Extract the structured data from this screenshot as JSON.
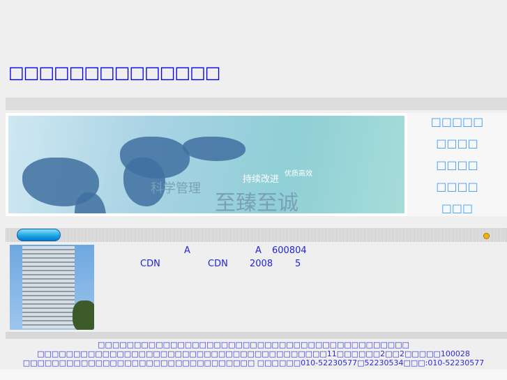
{
  "header": {
    "title": "□□□□□□□□□□□□□□"
  },
  "banner": {
    "slogan1": "科学管理",
    "slogan2": "至臻至诚",
    "slogan3": "持续改进",
    "slogan4": "优质高效"
  },
  "nav": {
    "items": [
      {
        "label": "□□□□□"
      },
      {
        "label": "□□□□"
      },
      {
        "label": "□□□□"
      },
      {
        "label": "□□□□"
      },
      {
        "label": "□□□"
      }
    ]
  },
  "content": {
    "row1": [
      "A",
      "A",
      "600804"
    ],
    "row2": [
      "CDN",
      "CDN",
      "2008",
      "5"
    ]
  },
  "footer": {
    "line1": "□□□□□□□□□□□□□□□□□□□□□□□□□□□□□□□□□□□□□□□□□□□",
    "line2": "□□□□□□□□□□□□□□□□□□□□□□□□□□□□□□□□□□□□□□□□11□□□□□□2□□2□□□□□100028",
    "line3": "□□□□□□□□□□□□□□□□□□□□□□□□□□□□□□□□ □□□□□□010-52230577□52230534□□□:010-52230577"
  },
  "colors": {
    "link": "#0000ee",
    "nav": "#3f9cf5"
  }
}
